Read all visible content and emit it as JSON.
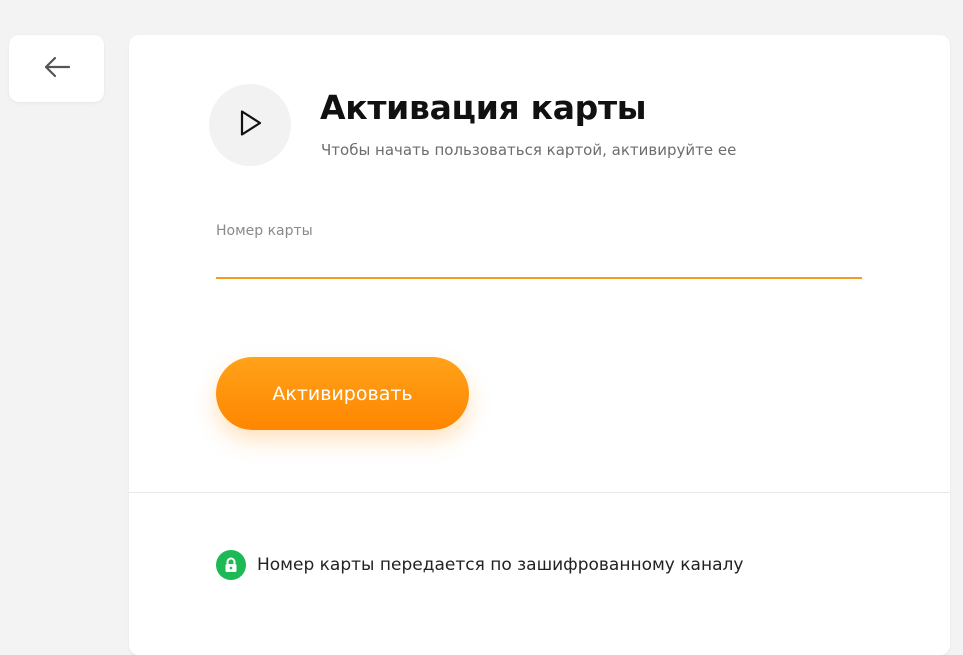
{
  "back_button": {
    "icon": "arrow-left-icon"
  },
  "header": {
    "icon": "play-icon",
    "title": "Активация карты",
    "subtitle": "Чтобы начать пользоваться картой, активируйте ее"
  },
  "form": {
    "card_number_label": "Номер карты",
    "card_number_value": "",
    "activate_label": "Активировать"
  },
  "footer": {
    "icon": "lock-icon",
    "secure_text": "Номер карты передается по зашифрованному каналу"
  },
  "colors": {
    "accent": "#ff8c00",
    "input_underline": "#f39c1f",
    "secure_badge": "#1db954",
    "background": "#f3f3f3"
  }
}
